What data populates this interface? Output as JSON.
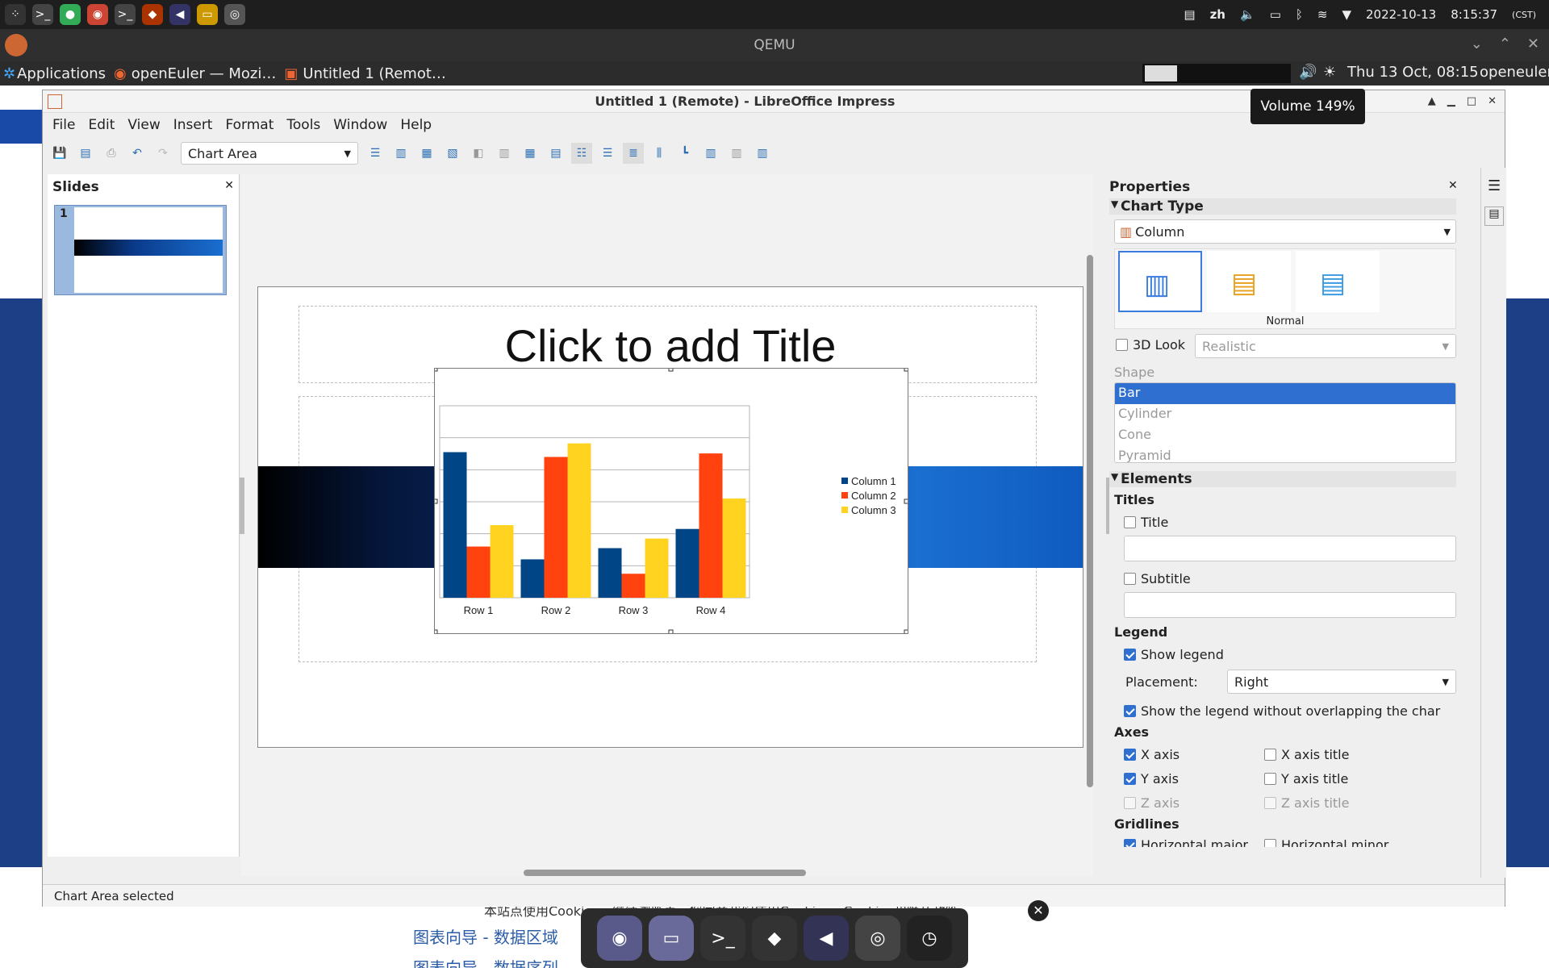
{
  "host": {
    "date": "2022-10-13",
    "time": "8:15:37",
    "tz": "(CST)",
    "lang": "zh",
    "vm_title": "QEMU"
  },
  "guest": {
    "apps_label": "Applications",
    "task1": "openEuler — Mozi…",
    "task2": "Untitled 1 (Remot…",
    "clock": "Thu 13 Oct, 08:15",
    "user": "openeuler",
    "volume": "Volume 149%"
  },
  "window": {
    "title": "Untitled 1 (Remote) - LibreOffice Impress"
  },
  "menu": [
    "File",
    "Edit",
    "View",
    "Insert",
    "Format",
    "Tools",
    "Window",
    "Help"
  ],
  "toolbar": {
    "selector": "Chart Area"
  },
  "slides_panel": {
    "title": "Slides",
    "thumb_number": "1"
  },
  "slide": {
    "title_placeholder": "Click to add Title"
  },
  "chart_data": {
    "type": "bar",
    "categories": [
      "Row 1",
      "Row 2",
      "Row 3",
      "Row 4"
    ],
    "series": [
      {
        "name": "Column 1",
        "values": [
          9.1,
          2.4,
          3.1,
          4.3
        ],
        "color": "#004586"
      },
      {
        "name": "Column 2",
        "values": [
          3.2,
          8.8,
          1.5,
          9.02
        ],
        "color": "#ff420e"
      },
      {
        "name": "Column 3",
        "values": [
          4.54,
          9.65,
          3.7,
          6.2
        ],
        "color": "#ffd320"
      }
    ],
    "ylim": [
      0,
      12
    ],
    "grid": true,
    "legend": "right"
  },
  "properties": {
    "title": "Properties",
    "chart_type_section": "Chart Type",
    "chart_type": "Column",
    "variant_caption": "Normal",
    "look3d_label": "3D Look",
    "look3d_value": "Realistic",
    "shape_label": "Shape",
    "shapes": [
      "Bar",
      "Cylinder",
      "Cone",
      "Pyramid"
    ],
    "elements_section": "Elements",
    "titles_label": "Titles",
    "title_chk": "Title",
    "subtitle_chk": "Subtitle",
    "legend_label": "Legend",
    "show_legend": "Show legend",
    "placement_label": "Placement:",
    "placement_value": "Right",
    "no_overlap": "Show the legend without overlapping the char",
    "axes_label": "Axes",
    "x_axis": "X axis",
    "x_axis_title": "X axis title",
    "y_axis": "Y axis",
    "y_axis_title": "Y axis title",
    "z_axis": "Z axis",
    "z_axis_title": "Z axis title",
    "gridlines_label": "Gridlines",
    "h_major": "Horizontal major",
    "h_minor": "Horizontal minor"
  },
  "status": {
    "text": "Chart Area selected"
  },
  "browser_bg": {
    "line1": "本站点使用Cookies，继续浏览表示您同意我们使用Cookies。Cookies和隐私政策。",
    "link1": "图表向导 - 数据区域",
    "link2": "图表向导 - 数据序列"
  }
}
